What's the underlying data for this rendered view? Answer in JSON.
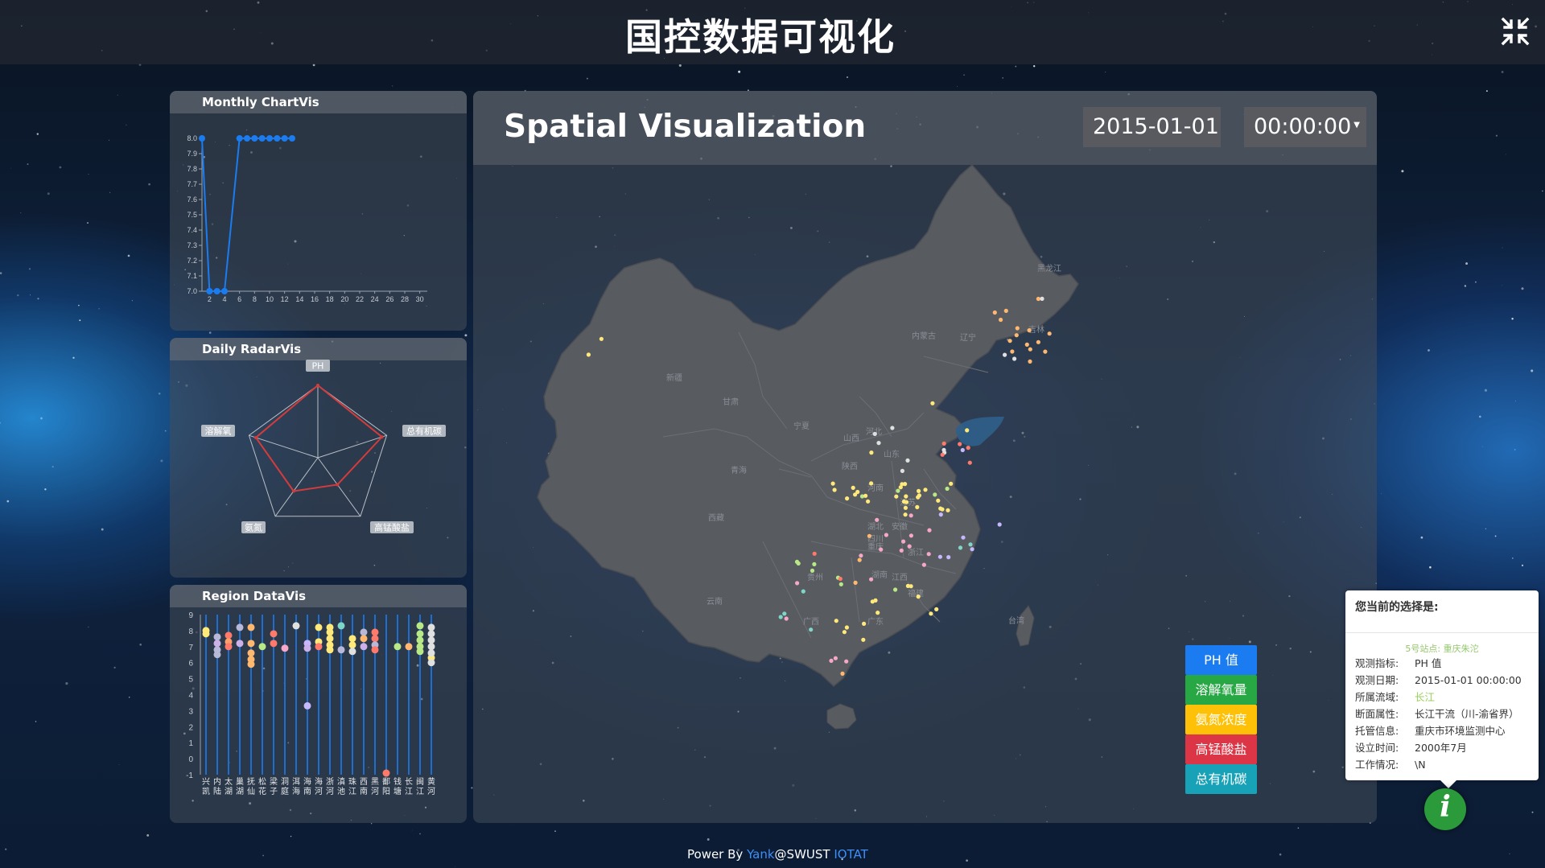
{
  "header": {
    "title": "国控数据可视化",
    "fullscreen_icon": "compress-icon"
  },
  "monthly_panel": {
    "title": "Monthly ChartVis"
  },
  "radar_panel": {
    "title": "Daily RadarVis"
  },
  "region_panel": {
    "title": "Region DataVis"
  },
  "spatial": {
    "title": "Spatial Visualization",
    "date": "2015-01-01",
    "time": "00:00:00"
  },
  "legend_buttons": [
    {
      "label": "PH 值",
      "color": "#1a7cf0"
    },
    {
      "label": "溶解氧量",
      "color": "#28a745"
    },
    {
      "label": "氨氮浓度",
      "color": "#ffc107"
    },
    {
      "label": "高锰酸盐",
      "color": "#dc3545"
    },
    {
      "label": "总有机碳",
      "color": "#17a2b8"
    }
  ],
  "info_box": {
    "title": "您当前的选择是:",
    "site": "5号站点: 重庆朱沱",
    "rows": [
      {
        "key": "观测指标:",
        "value": "PH 值"
      },
      {
        "key": "观测日期:",
        "value": "2015-01-01 00:00:00"
      },
      {
        "key": "所属流域:",
        "value": "长江",
        "highlight": true
      },
      {
        "key": "断面属性:",
        "value": "长江干流（川-渝省界）"
      },
      {
        "key": "托管信息:",
        "value": "重庆市环境监测中心"
      },
      {
        "key": "设立时间:",
        "value": "2000年7月"
      },
      {
        "key": "工作情况:",
        "value": "\\N"
      }
    ]
  },
  "info_button": {
    "label": "i"
  },
  "footer": {
    "prefix": "Power By ",
    "author": "Yank",
    "middle": "@SWUST ",
    "org": "IOTAT"
  },
  "map": {
    "province_labels": [
      "黑龙江",
      "吉林",
      "辽宁",
      "内蒙古",
      "新疆",
      "甘肃",
      "宁夏",
      "青海",
      "西藏",
      "山西",
      "河北",
      "山东",
      "陕西",
      "河南",
      "江苏",
      "安徽",
      "四川",
      "重庆",
      "湖北",
      "浙江",
      "湖南",
      "江西",
      "贵州",
      "福建",
      "云南",
      "广西",
      "广东",
      "台湾"
    ],
    "station_colors": [
      "#ffb870",
      "#e0e0e0",
      "#ffe97a",
      "#b8e986",
      "#ff7a6b",
      "#c6b7ff",
      "#7ed6c8",
      "#f7a7c8"
    ]
  },
  "chart_data": [
    {
      "type": "line",
      "title": "Monthly ChartVis",
      "x": [
        1,
        2,
        3,
        4,
        6,
        7,
        8,
        9,
        10,
        11,
        12,
        13
      ],
      "y": [
        8.0,
        7.0,
        7.0,
        7.0,
        8.0,
        8.0,
        8.0,
        8.0,
        8.0,
        8.0,
        8.0,
        8.0
      ],
      "xticks": [
        "2",
        "4",
        "6",
        "8",
        "10",
        "12",
        "14",
        "16",
        "18",
        "20",
        "22",
        "24",
        "26",
        "28",
        "30"
      ],
      "yticks": [
        "7.0",
        "7.1",
        "7.2",
        "7.3",
        "7.4",
        "7.5",
        "7.6",
        "7.7",
        "7.8",
        "7.9",
        "8.0"
      ],
      "xlim": [
        1,
        31
      ],
      "ylim": [
        7.0,
        8.0
      ],
      "color": "#1a7cf0"
    },
    {
      "type": "radar",
      "title": "Daily RadarVis",
      "indicators": [
        "PH",
        "总有机碳",
        "高锰酸盐",
        "氨氮",
        "溶解氧"
      ],
      "values": [
        1.0,
        0.93,
        0.46,
        0.57,
        0.9
      ],
      "color": "#d23c3c"
    },
    {
      "type": "scatter",
      "title": "Region DataVis",
      "categories": [
        "兴凯",
        "内陆",
        "太湖",
        "巢湖",
        "抚仙",
        "松花",
        "梁子",
        "洞庭",
        "洱海",
        "海南",
        "海河",
        "浙河",
        "滇池",
        "珠江",
        "西南",
        "黑河",
        "鄱阳",
        "钱塘",
        "长江",
        "闽江",
        "黄河"
      ],
      "ylim": [
        -1,
        9
      ],
      "yticks": [
        "-1",
        "0",
        "1",
        "2",
        "3",
        "4",
        "5",
        "6",
        "7",
        "8",
        "9"
      ],
      "points": [
        {
          "c": 0,
          "y": 8.0,
          "color": "#ffe97a"
        },
        {
          "c": 0,
          "y": 7.8,
          "color": "#ffe97a"
        },
        {
          "c": 1,
          "y": 7.6,
          "color": "#b8b8d8"
        },
        {
          "c": 1,
          "y": 7.2,
          "color": "#ccb0e8"
        },
        {
          "c": 1,
          "y": 6.8,
          "color": "#b8b8d8"
        },
        {
          "c": 1,
          "y": 6.5,
          "color": "#b8b8d8"
        },
        {
          "c": 2,
          "y": 7.7,
          "color": "#ff7a6b"
        },
        {
          "c": 2,
          "y": 7.3,
          "color": "#ff9f6b"
        },
        {
          "c": 2,
          "y": 7.0,
          "color": "#ff7a6b"
        },
        {
          "c": 3,
          "y": 8.2,
          "color": "#b8b8d8"
        },
        {
          "c": 3,
          "y": 7.2,
          "color": "#ccb0e8"
        },
        {
          "c": 4,
          "y": 8.2,
          "color": "#ffb870"
        },
        {
          "c": 4,
          "y": 7.2,
          "color": "#ffb870"
        },
        {
          "c": 4,
          "y": 6.6,
          "color": "#ffb870"
        },
        {
          "c": 4,
          "y": 6.2,
          "color": "#ffb870"
        },
        {
          "c": 4,
          "y": 5.9,
          "color": "#ffb870"
        },
        {
          "c": 5,
          "y": 7.0,
          "color": "#b8e986"
        },
        {
          "c": 6,
          "y": 7.8,
          "color": "#ff7a6b"
        },
        {
          "c": 6,
          "y": 7.2,
          "color": "#ff7a6b"
        },
        {
          "c": 7,
          "y": 6.9,
          "color": "#f7a7c8"
        },
        {
          "c": 8,
          "y": 8.3,
          "color": "#e0e0e0"
        },
        {
          "c": 9,
          "y": 7.2,
          "color": "#c6b7ff"
        },
        {
          "c": 9,
          "y": 6.9,
          "color": "#ccb0e8"
        },
        {
          "c": 9,
          "y": 3.3,
          "color": "#c6b7ff"
        },
        {
          "c": 10,
          "y": 8.2,
          "color": "#ffe97a"
        },
        {
          "c": 10,
          "y": 7.3,
          "color": "#ffe97a"
        },
        {
          "c": 10,
          "y": 7.0,
          "color": "#ff7a6b"
        },
        {
          "c": 11,
          "y": 8.2,
          "color": "#ffe97a"
        },
        {
          "c": 11,
          "y": 7.9,
          "color": "#ffe97a"
        },
        {
          "c": 11,
          "y": 7.5,
          "color": "#ffe97a"
        },
        {
          "c": 11,
          "y": 7.1,
          "color": "#ffe97a"
        },
        {
          "c": 11,
          "y": 6.8,
          "color": "#ffe97a"
        },
        {
          "c": 12,
          "y": 8.3,
          "color": "#7ed6c8"
        },
        {
          "c": 12,
          "y": 6.8,
          "color": "#b8b8d8"
        },
        {
          "c": 13,
          "y": 7.5,
          "color": "#ffe97a"
        },
        {
          "c": 13,
          "y": 7.1,
          "color": "#ffe97a"
        },
        {
          "c": 13,
          "y": 6.7,
          "color": "#e0e0e0"
        },
        {
          "c": 14,
          "y": 7.9,
          "color": "#b8b8d8"
        },
        {
          "c": 14,
          "y": 7.5,
          "color": "#ffb870"
        },
        {
          "c": 14,
          "y": 7.0,
          "color": "#ccb0e8"
        },
        {
          "c": 15,
          "y": 7.9,
          "color": "#ff7a6b"
        },
        {
          "c": 15,
          "y": 7.5,
          "color": "#ff7a6b"
        },
        {
          "c": 15,
          "y": 7.1,
          "color": "#b8b8d8"
        },
        {
          "c": 15,
          "y": 6.8,
          "color": "#ff7a6b"
        },
        {
          "c": 16,
          "y": -0.9,
          "color": "#ff7a6b"
        },
        {
          "c": 17,
          "y": 7.0,
          "color": "#b8e986"
        },
        {
          "c": 18,
          "y": 7.0,
          "color": "#ffb870"
        },
        {
          "c": 19,
          "y": 8.3,
          "color": "#b8e986"
        },
        {
          "c": 19,
          "y": 7.8,
          "color": "#b8e986"
        },
        {
          "c": 19,
          "y": 7.4,
          "color": "#b8e986"
        },
        {
          "c": 19,
          "y": 7.0,
          "color": "#b8e986"
        },
        {
          "c": 19,
          "y": 6.7,
          "color": "#b8e986"
        },
        {
          "c": 20,
          "y": 6.3,
          "color": "#ffe97a"
        },
        {
          "c": 20,
          "y": 8.2,
          "color": "#e0e0e0"
        },
        {
          "c": 20,
          "y": 7.8,
          "color": "#e0e0e0"
        },
        {
          "c": 20,
          "y": 7.4,
          "color": "#e0e0e0"
        },
        {
          "c": 20,
          "y": 7.0,
          "color": "#e0e0e0"
        },
        {
          "c": 20,
          "y": 6.6,
          "color": "#e0e0e0"
        },
        {
          "c": 20,
          "y": 6.0,
          "color": "#e0e0e0"
        }
      ],
      "line_color": "#1a7cf0"
    }
  ]
}
